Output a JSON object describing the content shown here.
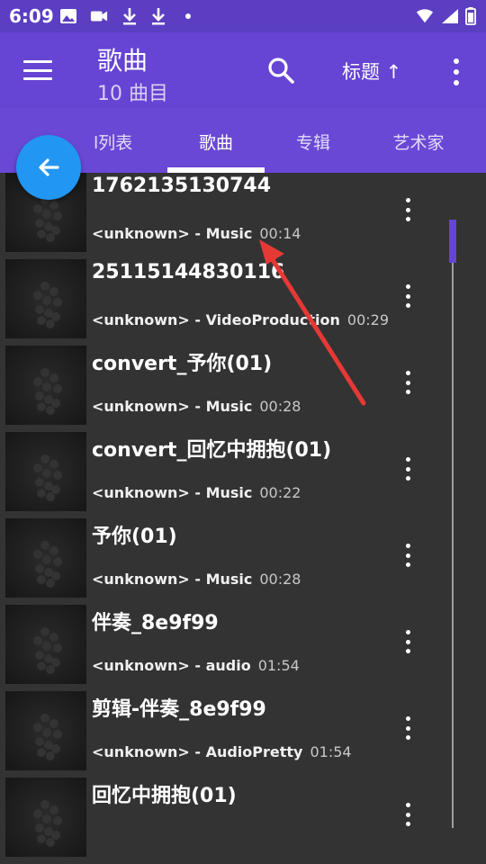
{
  "status_bar": {
    "time": "6:09",
    "icons": [
      "image-icon",
      "video-camera-icon",
      "download-icon",
      "download-icon",
      "dot"
    ],
    "right_icons": [
      "wifi-icon",
      "signal-icon",
      "battery-icon"
    ]
  },
  "toolbar": {
    "title": "歌曲",
    "subtitle": "10 曲目",
    "sort_label": "标题 ↑",
    "icons": {
      "menu": "menu-icon",
      "search": "search-icon",
      "more": "more-vert-icon"
    }
  },
  "tabs": [
    {
      "label": "放列表",
      "visible_label": "l列表"
    },
    {
      "label": "歌曲",
      "active": true
    },
    {
      "label": "专辑"
    },
    {
      "label": "艺术家"
    }
  ],
  "fab": {
    "icon": "arrow-back-icon"
  },
  "songs": [
    {
      "title": "1762135130744",
      "meta": "<unknown> - Music",
      "duration": "00:14"
    },
    {
      "title": "25115144830116",
      "meta": "<unknown> - VideoProduction",
      "duration": "00:29"
    },
    {
      "title": "convert_予你(01)",
      "meta": "<unknown> - Music",
      "duration": "00:28"
    },
    {
      "title": "convert_回忆中拥抱(01)",
      "meta": "<unknown> - Music",
      "duration": "00:22"
    },
    {
      "title": "予你(01)",
      "meta": "<unknown> - Music",
      "duration": "00:28"
    },
    {
      "title": "伴奏_8e9f99",
      "meta": "<unknown> - audio",
      "duration": "01:54"
    },
    {
      "title": "剪辑-伴奏_8e9f99",
      "meta": "<unknown> - AudioPretty",
      "duration": "01:54"
    },
    {
      "title": "回忆中拥抱(01)",
      "meta": "",
      "duration": ""
    }
  ],
  "colors": {
    "status_bar": "#5b3ec1",
    "toolbar": "#6644d4",
    "tabs": "#6a48d6",
    "list_bg": "#333333",
    "fab": "#2196f3",
    "annotation_arrow": "#e53935"
  }
}
